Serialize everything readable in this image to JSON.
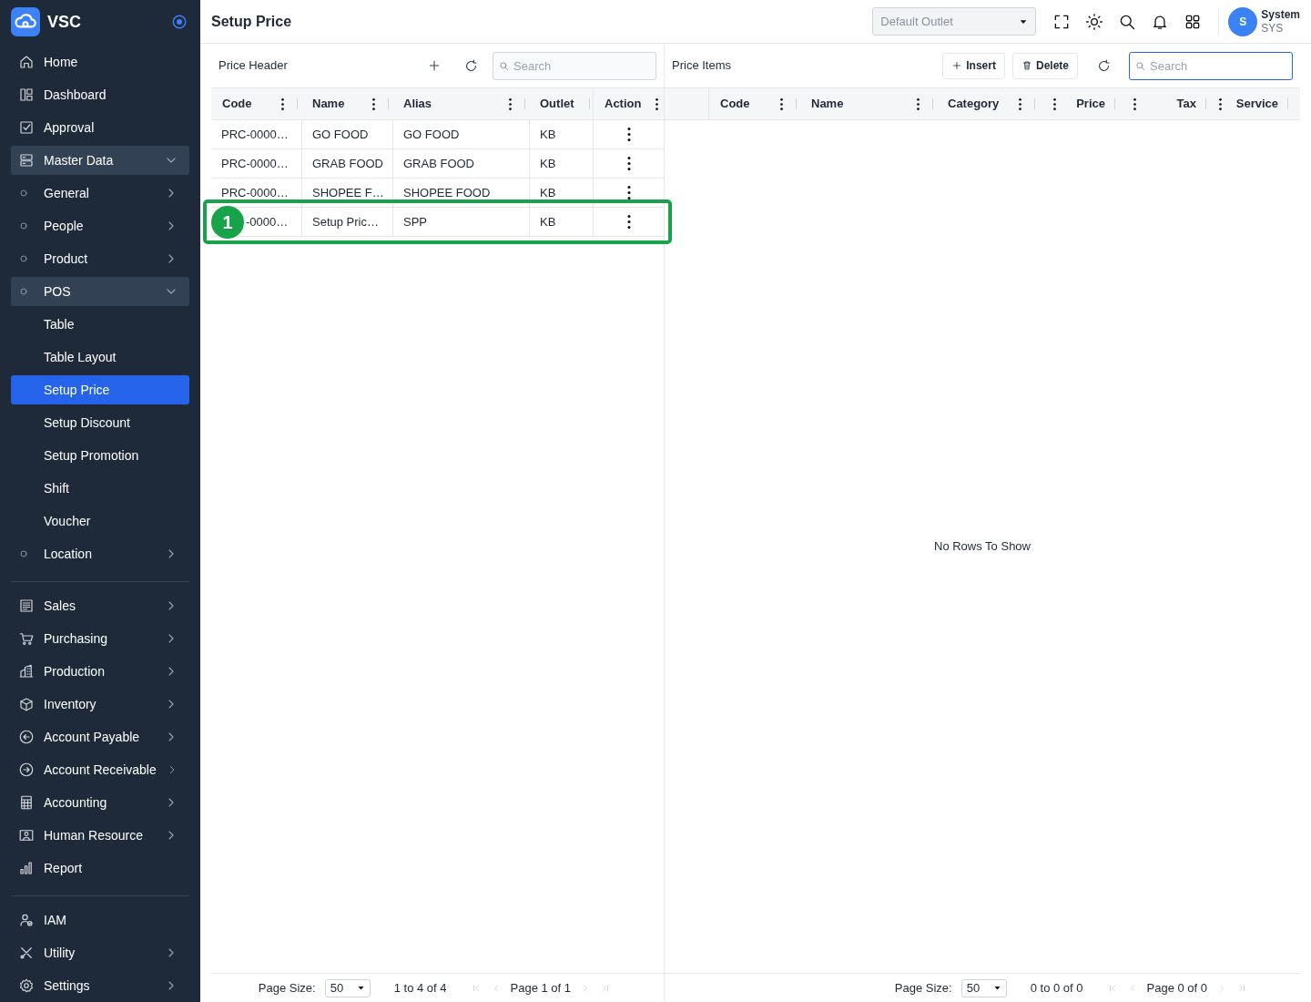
{
  "brand": {
    "name": "VSC"
  },
  "sidebar": {
    "sections": [
      {
        "items": [
          {
            "label": "Home",
            "selected": false
          },
          {
            "label": "Dashboard",
            "selected": false
          },
          {
            "label": "Approval",
            "selected": false
          },
          {
            "label": "Master Data",
            "selected": false,
            "expanded": true,
            "children": [
              {
                "label": "General",
                "selected": false,
                "expanded": false
              },
              {
                "label": "People",
                "selected": false,
                "expanded": false
              },
              {
                "label": "Product",
                "selected": false,
                "expanded": false
              },
              {
                "label": "POS",
                "selected": false,
                "expanded": true,
                "children": [
                  {
                    "label": "Table",
                    "selected": false
                  },
                  {
                    "label": "Table Layout",
                    "selected": false
                  },
                  {
                    "label": "Setup Price",
                    "selected": true
                  },
                  {
                    "label": "Setup Discount",
                    "selected": false
                  },
                  {
                    "label": "Setup Promotion",
                    "selected": false
                  },
                  {
                    "label": "Shift",
                    "selected": false
                  },
                  {
                    "label": "Voucher",
                    "selected": false
                  }
                ]
              },
              {
                "label": "Location",
                "selected": false,
                "expanded": false
              }
            ]
          }
        ]
      },
      {
        "items": [
          {
            "label": "Sales",
            "selected": false,
            "expanded": false
          },
          {
            "label": "Purchasing",
            "selected": false,
            "expanded": false
          },
          {
            "label": "Production",
            "selected": false,
            "expanded": false
          },
          {
            "label": "Inventory",
            "selected": false,
            "expanded": false
          },
          {
            "label": "Account Payable",
            "selected": false,
            "expanded": false
          },
          {
            "label": "Account Receivable",
            "selected": false,
            "expanded": false
          },
          {
            "label": "Accounting",
            "selected": false,
            "expanded": false
          },
          {
            "label": "Human Resource",
            "selected": false,
            "expanded": false
          },
          {
            "label": "Report",
            "selected": false
          }
        ]
      },
      {
        "items": [
          {
            "label": "IAM",
            "selected": false
          },
          {
            "label": "Utility",
            "selected": false,
            "expanded": false
          },
          {
            "label": "Settings",
            "selected": false,
            "expanded": false
          }
        ]
      }
    ]
  },
  "header": {
    "title": "Setup Price",
    "outlet_select": {
      "placeholder": "Default Outlet",
      "disabled": true
    },
    "user": {
      "initial": "S",
      "name": "System",
      "code": "SYS"
    }
  },
  "price_header": {
    "title": "Price Header",
    "search": {
      "placeholder": "Search"
    },
    "columns": [
      {
        "label": "Code",
        "kind": "text",
        "menu": true
      },
      {
        "label": "Name",
        "kind": "text",
        "menu": true
      },
      {
        "label": "Alias",
        "kind": "text",
        "menu": true
      },
      {
        "label": "Outlet",
        "kind": "text",
        "menu": false
      },
      {
        "label": "Action",
        "kind": "action",
        "menu": true
      }
    ],
    "rows": [
      {
        "cells": [
          "PRC-0000…",
          "GO FOOD",
          "GO FOOD",
          "KB"
        ]
      },
      {
        "cells": [
          "PRC-0000…",
          "GRAB FOOD",
          "GRAB FOOD",
          "KB"
        ]
      },
      {
        "cells": [
          "PRC-0000…",
          "SHOPEE F…",
          "SHOPEE FOOD",
          "KB"
        ]
      },
      {
        "cells": [
          "-0000…",
          "Setup Pric…",
          "SPP",
          "KB"
        ],
        "annotation": "1"
      }
    ],
    "pagination": {
      "page_size_label": "Page Size:",
      "page_size": "50",
      "range": "1 to 4 of 4",
      "page": "Page 1 of 1"
    }
  },
  "price_items": {
    "title": "Price Items",
    "insert_label": "Insert",
    "delete_label": "Delete",
    "search": {
      "placeholder": "Search",
      "focused": true
    },
    "columns": [
      {
        "label": "Code",
        "kind": "text",
        "menu": true
      },
      {
        "label": "Name",
        "kind": "text",
        "menu": true
      },
      {
        "label": "Category",
        "kind": "text",
        "menu": true
      },
      {
        "label": "Price",
        "kind": "number",
        "menu": true
      },
      {
        "label": "Tax",
        "kind": "number",
        "menu": true
      },
      {
        "label": "Service",
        "kind": "number",
        "menu": true
      }
    ],
    "empty_message": "No Rows To Show",
    "pagination": {
      "page_size_label": "Page Size:",
      "page_size": "50",
      "range": "0 to 0 of 0",
      "page": "Page 0 of 0"
    }
  }
}
